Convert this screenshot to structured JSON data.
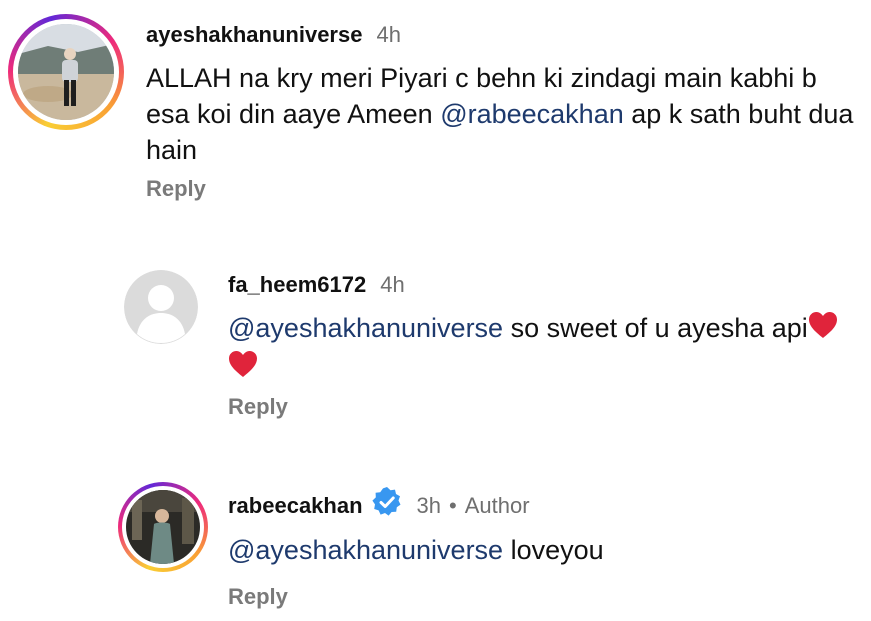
{
  "comments": [
    {
      "username": "ayeshakhanuniverse",
      "time": "4h",
      "text_parts": [
        "ALLAH na kry meri Piyari c behn ki zindagi main kabhi b esa koi din aaye Ameen ",
        "@rabeecakhan",
        " ap k sath buht dua hain"
      ],
      "reply_label": "Reply"
    },
    {
      "username": "fa_heem6172",
      "time": "4h",
      "text_parts": [
        "@ayeshakhanuniverse",
        " so sweet of u ayesha api"
      ],
      "emoji": "red-heart",
      "reply_label": "Reply"
    },
    {
      "username": "rabeecakhan",
      "time": "3h",
      "badge": "verified-icon",
      "separator": "•",
      "role": "Author",
      "text_parts": [
        "@ayeshakhanuniverse",
        " loveyou"
      ],
      "reply_label": "Reply"
    }
  ],
  "colors": {
    "mention": "#1e3a6d",
    "muted": "#6f6f6f",
    "verified": "#3897f0",
    "heart": "#e0243b"
  }
}
